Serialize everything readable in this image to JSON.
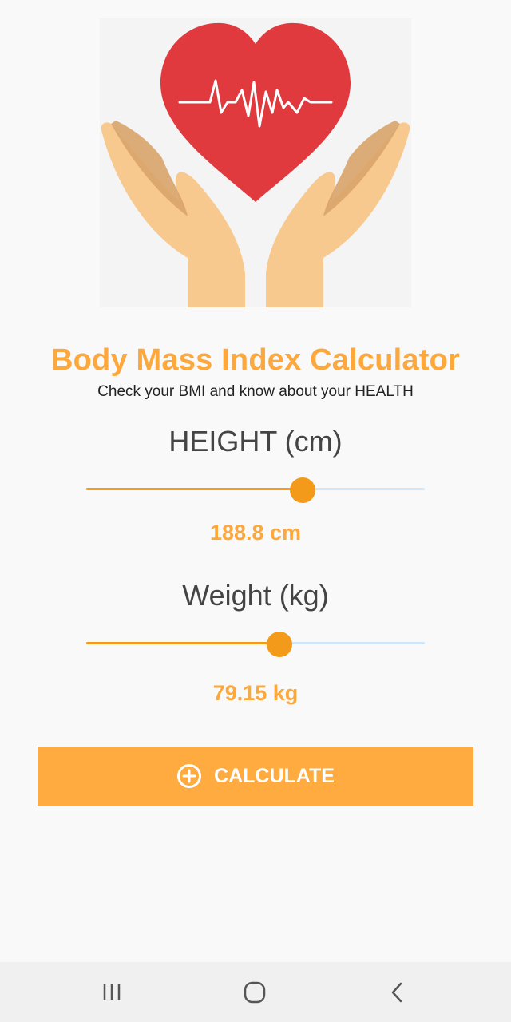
{
  "app": {
    "title": "Body Mass Index Calculator",
    "subtitle": "Check your BMI and know about your HEALTH",
    "accent_color": "#fca83c",
    "button_color": "#ffab40"
  },
  "hero": {
    "image": "heart-with-hands-illustration"
  },
  "height": {
    "label": "HEIGHT (cm)",
    "value_text": "188.8 cm",
    "slider_fraction": 0.64
  },
  "weight": {
    "label": "Weight (kg)",
    "value_text": "79.15 kg",
    "slider_fraction": 0.57
  },
  "calculate": {
    "label": "CALCULATE",
    "icon": "plus-circle-icon"
  },
  "navbar": {
    "recent_icon": "recent-apps-icon",
    "home_icon": "home-icon",
    "back_icon": "back-icon"
  }
}
